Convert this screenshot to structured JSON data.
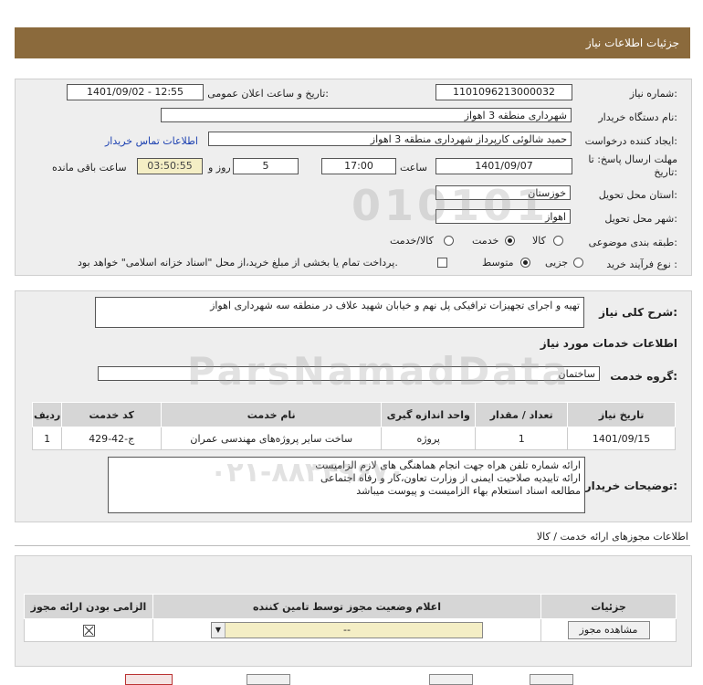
{
  "header": {
    "title": "جزئیات اطلاعات نیاز"
  },
  "form": {
    "need_number_label": "شماره نیاز:",
    "need_number": "1101096213000032",
    "announce_label": "تاریخ و ساعت اعلان عمومی:",
    "announce_value": "1401/09/02 - 12:55",
    "buyer_org_label": "نام دستگاه خریدار:",
    "buyer_org": "شهرداری منطقه 3 اهواز",
    "requester_label": "ایجاد کننده درخواست:",
    "requester": "حمید شالوئی کارپرداز شهرداری منطقه 3 اهواز",
    "contact_link": "اطلاعات تماس خریدار",
    "deadline_label": "مهلت ارسال پاسخ: تا",
    "deadline_label2": "تاریخ:",
    "deadline_date": "1401/09/07",
    "time_label": "ساعت",
    "deadline_time": "17:00",
    "days_value": "5",
    "days_label": "روز و",
    "remaining_time": "03:50:55",
    "remaining_label": "ساعت باقی مانده",
    "province_label": "استان محل تحویل:",
    "province": "خوزستان",
    "city_label": "شهر محل تحویل:",
    "city": "اهواز",
    "category_label": "طبقه بندی موضوعی:",
    "category_options": [
      "کالا",
      "خدمت",
      "کالا/خدمت"
    ],
    "category_selected": "خدمت",
    "purchase_type_label": "نوع فرآیند خرید :",
    "purchase_options": [
      "جزیی",
      "متوسط"
    ],
    "purchase_selected": "متوسط",
    "payment_note": "پرداخت تمام یا بخشی از مبلغ خرید،از محل \"اسناد خزانه اسلامی\" خواهد بود."
  },
  "need": {
    "summary_label": "شرح کلی نیاز:",
    "summary": "تهیه و اجرای تجهیزات ترافیکی پل نهم و خیابان شهید علاف در منطقه سه شهرداری اهواز",
    "services_title": "اطلاعات خدمات مورد نیاز",
    "service_group_label": "گروه خدمت:",
    "service_group": "ساختمان",
    "table": {
      "headers": [
        "ردیف",
        "کد خدمت",
        "نام خدمت",
        "واحد اندازه گیری",
        "تعداد / مقدار",
        "تاریخ نیاز"
      ],
      "rows": [
        [
          "1",
          "ج-42-429",
          "ساخت سایر پروژه‌های مهندسی عمران",
          "پروژه",
          "1",
          "1401/09/15"
        ]
      ]
    },
    "buyer_notes_label": "توضیحات خریدار:",
    "buyer_notes": [
      "ارائه شماره تلفن هراه جهت انجام هماهنگی های لازم الزامیست",
      "ارائه تاییدیه صلاحیت ایمنی از وزارت تعاون،کار و رفاه اجتماعی",
      "مطالعه اسناد استعلام بهاء الزامیست و پیوست میباشد"
    ]
  },
  "permits": {
    "section_title": "اطلاعات مجوزهای ارائه خدمت / کالا",
    "headers": [
      "الزامی بودن ارائه مجوز",
      "اعلام وضعیت مجوز توسط تامین کننده",
      "جزئیات"
    ],
    "status_value": "--",
    "view_button": "مشاهده مجوز"
  },
  "watermark": {
    "brand": "ParsNamadData",
    "digits": "010101",
    "phone": "۰۲۱-۸۸۳۴۹۶۷۰"
  }
}
